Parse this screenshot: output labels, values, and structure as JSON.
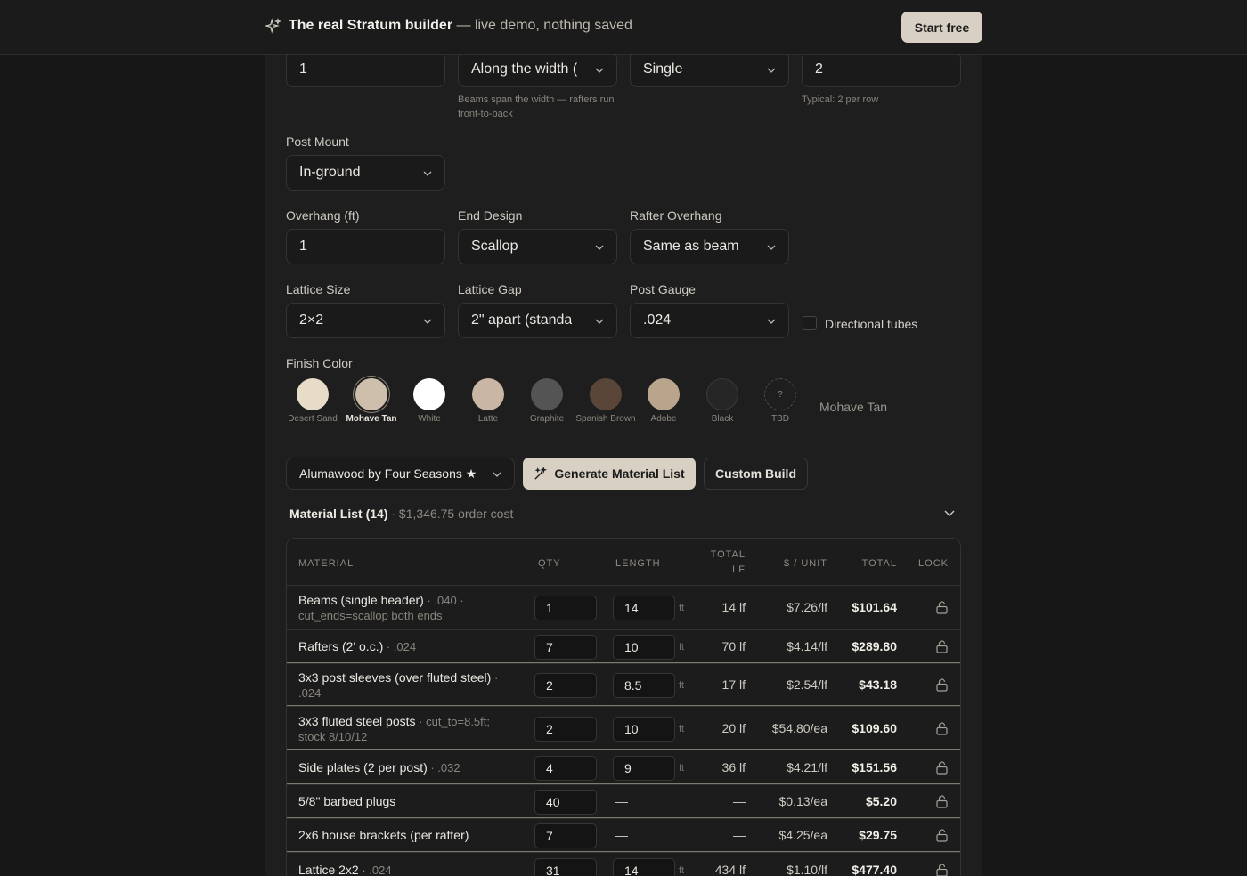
{
  "topbar": {
    "brand_title": "The real Stratum builder",
    "brand_sub": " — live demo, nothing saved",
    "start_label": "Start free",
    "icon": "sparkle-icon"
  },
  "row1": {
    "beams_count": "1",
    "beam_direction": "Along the width (",
    "beam_direction_hint": "Beams span the width — rafters run front-to-back",
    "header_type": "Single",
    "posts_per_row": "2",
    "posts_hint": "Typical: 2 per row"
  },
  "post_mount": {
    "label": "Post Mount",
    "value": "In-ground"
  },
  "overhang": {
    "label": "Overhang (ft)",
    "value": "1"
  },
  "end_design": {
    "label": "End Design",
    "value": "Scallop"
  },
  "rafter_overhang": {
    "label": "Rafter Overhang",
    "value": "Same as beam"
  },
  "lattice_size": {
    "label": "Lattice Size",
    "value": "2×2"
  },
  "lattice_gap": {
    "label": "Lattice Gap",
    "value": "2\" apart (standa"
  },
  "post_gauge": {
    "label": "Post Gauge",
    "value": ".024"
  },
  "directional_tubes": {
    "label": "Directional tubes",
    "checked": false
  },
  "finish": {
    "label": "Finish Color",
    "selected_name": "Mohave Tan",
    "colors": [
      {
        "name": "Desert Sand",
        "hex": "#e6dcc8"
      },
      {
        "name": "Mohave Tan",
        "hex": "#cdbfab"
      },
      {
        "name": "White",
        "hex": "#ffffff"
      },
      {
        "name": "Latte",
        "hex": "#c9b6a4"
      },
      {
        "name": "Graphite",
        "hex": "#545454"
      },
      {
        "name": "Spanish Brown",
        "hex": "#5a4638"
      },
      {
        "name": "Adobe",
        "hex": "#b9a58b"
      },
      {
        "name": "Black",
        "hex": "#262626"
      }
    ],
    "tbd_label": "TBD",
    "tbd_glyph": "?"
  },
  "actions": {
    "brand_select": "Alumawood by Four Seasons ★",
    "generate_label": "Generate Material List",
    "custom_label": "Custom Build"
  },
  "materials": {
    "title": "Material List (14)",
    "cost": " · $1,346.75 order cost",
    "headers": {
      "material": "MATERIAL",
      "qty": "QTY",
      "length": "LENGTH",
      "total_lf_1": "TOTAL",
      "total_lf_2": "LF",
      "unit": "$ / UNIT",
      "total": "TOTAL",
      "lock": "LOCK"
    },
    "rows": [
      {
        "name": "Beams (single header)",
        "meta": " · .040 · cut_ends=scallop both ends",
        "qty": "1",
        "length": "14",
        "unit_ft": "ft",
        "total_lf": "14 lf",
        "unit": "$7.26/lf",
        "total": "$101.64"
      },
      {
        "name": "Rafters (2' o.c.)",
        "meta": " · .024",
        "qty": "7",
        "length": "10",
        "unit_ft": "ft",
        "total_lf": "70 lf",
        "unit": "$4.14/lf",
        "total": "$289.80"
      },
      {
        "name": "3x3 post sleeves (over fluted steel)",
        "meta": " · .024",
        "qty": "2",
        "length": "8.5",
        "unit_ft": "ft",
        "total_lf": "17 lf",
        "unit": "$2.54/lf",
        "total": "$43.18"
      },
      {
        "name": "3x3 fluted steel posts",
        "meta": " · cut_to=8.5ft; stock 8/10/12",
        "qty": "2",
        "length": "10",
        "unit_ft": "ft",
        "total_lf": "20 lf",
        "unit": "$54.80/ea",
        "total": "$109.60"
      },
      {
        "name": "Side plates (2 per post)",
        "meta": " · .032",
        "qty": "4",
        "length": "9",
        "unit_ft": "ft",
        "total_lf": "36 lf",
        "unit": "$4.21/lf",
        "total": "$151.56"
      },
      {
        "name": "5/8\" barbed plugs",
        "meta": "",
        "qty": "40",
        "length": "—",
        "unit_ft": "",
        "total_lf": "—",
        "unit": "$0.13/ea",
        "total": "$5.20"
      },
      {
        "name": "2x6 house brackets (per rafter)",
        "meta": "",
        "qty": "7",
        "length": "—",
        "unit_ft": "",
        "total_lf": "—",
        "unit": "$4.25/ea",
        "total": "$29.75"
      },
      {
        "name": "Lattice 2x2",
        "meta": " · .024",
        "qty": "31",
        "length": "14",
        "unit_ft": "ft",
        "total_lf": "434 lf",
        "unit": "$1.10/lf",
        "total": "$477.40"
      }
    ]
  }
}
